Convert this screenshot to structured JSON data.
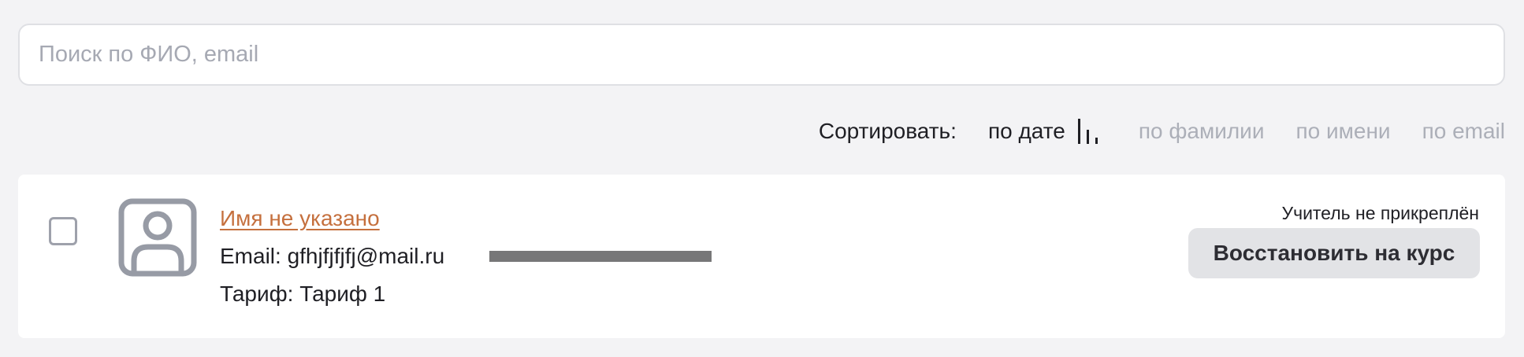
{
  "search": {
    "placeholder": "Поиск по ФИО, email",
    "value": ""
  },
  "sort": {
    "label": "Сортировать:",
    "options": [
      {
        "label": "по дате",
        "active": true
      },
      {
        "label": "по фамилии",
        "active": false
      },
      {
        "label": "по имени",
        "active": false
      },
      {
        "label": "по email",
        "active": false
      }
    ],
    "direction_icon": "sort-descending-icon"
  },
  "student": {
    "name": "Имя не указано",
    "email_label": "Email:",
    "email_value": "gfhjfjfjfj@mail.ru",
    "tariff_label": "Тариф:",
    "tariff_value": "Тариф 1",
    "teacher_status": "Учитель не прикреплён",
    "restore_label": "Восстановить на курс",
    "avatar_icon": "user-avatar-icon",
    "checkbox_checked": false
  },
  "colors": {
    "background": "#f3f3f5",
    "accent_link": "#c5703e",
    "muted_text": "#acafb8",
    "button_bg": "#e2e3e6"
  }
}
